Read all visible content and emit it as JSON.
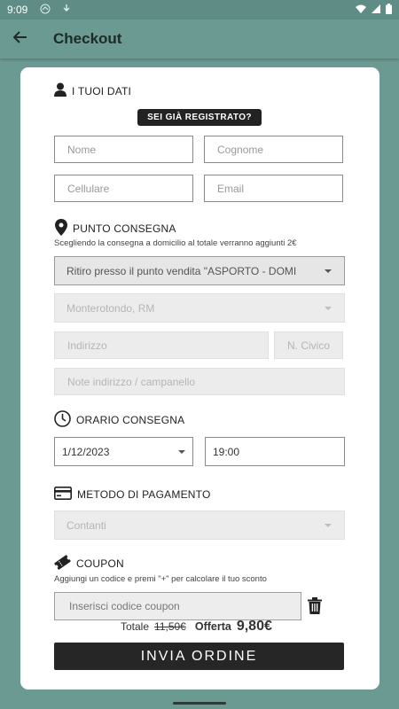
{
  "status_bar": {
    "time": "9:09"
  },
  "app_bar": {
    "title": "Checkout"
  },
  "sections": {
    "personal": {
      "title": "I TUOI DATI",
      "registered_label": "SEI GIÀ REGISTRATO?"
    },
    "delivery": {
      "title": "PUNTO CONSEGNA",
      "hint": "Scegliendo la consegna a domicilio al totale verranno aggiunti 2€"
    },
    "time": {
      "title": "ORARIO CONSEGNA"
    },
    "payment": {
      "title": "METODO DI PAGAMENTO"
    },
    "coupon": {
      "title": "COUPON",
      "hint": "Aggiungi un codice e premi \"+\" per calcolare il tuo sconto"
    }
  },
  "fields": {
    "nome": {
      "placeholder": "Nome"
    },
    "cognome": {
      "placeholder": "Cognome"
    },
    "cellulare": {
      "placeholder": "Cellulare"
    },
    "email": {
      "placeholder": "Email"
    },
    "delivery_point": {
      "value": "Ritiro presso il punto vendita \"ASPORTO - DOMI"
    },
    "city": {
      "value": "Monterotondo, RM"
    },
    "address": {
      "placeholder": "Indirizzo"
    },
    "civic": {
      "placeholder": "N. Civico"
    },
    "notes": {
      "placeholder": "Note indirizzo / campanello"
    },
    "date": {
      "value": "1/12/2023"
    },
    "hour": {
      "value": "19:00"
    },
    "payment_method": {
      "value": "Contanti"
    },
    "coupon": {
      "placeholder": "Inserisci codice coupon"
    }
  },
  "totals": {
    "total_label": "Totale",
    "total_old": "11,50€",
    "offer_label": "Offerta",
    "offer_value": "9,80€"
  },
  "submit_label": "INVIA ORDINE",
  "icons": {
    "back": "arrow-left-icon",
    "user": "user-icon",
    "location": "location-pin-icon",
    "clock": "clock-icon",
    "card": "credit-card-icon",
    "coupon": "ticket-icon",
    "trash": "trash-icon"
  },
  "colors": {
    "background": "#6a9a91",
    "card": "#ffffff",
    "button": "#262626"
  }
}
